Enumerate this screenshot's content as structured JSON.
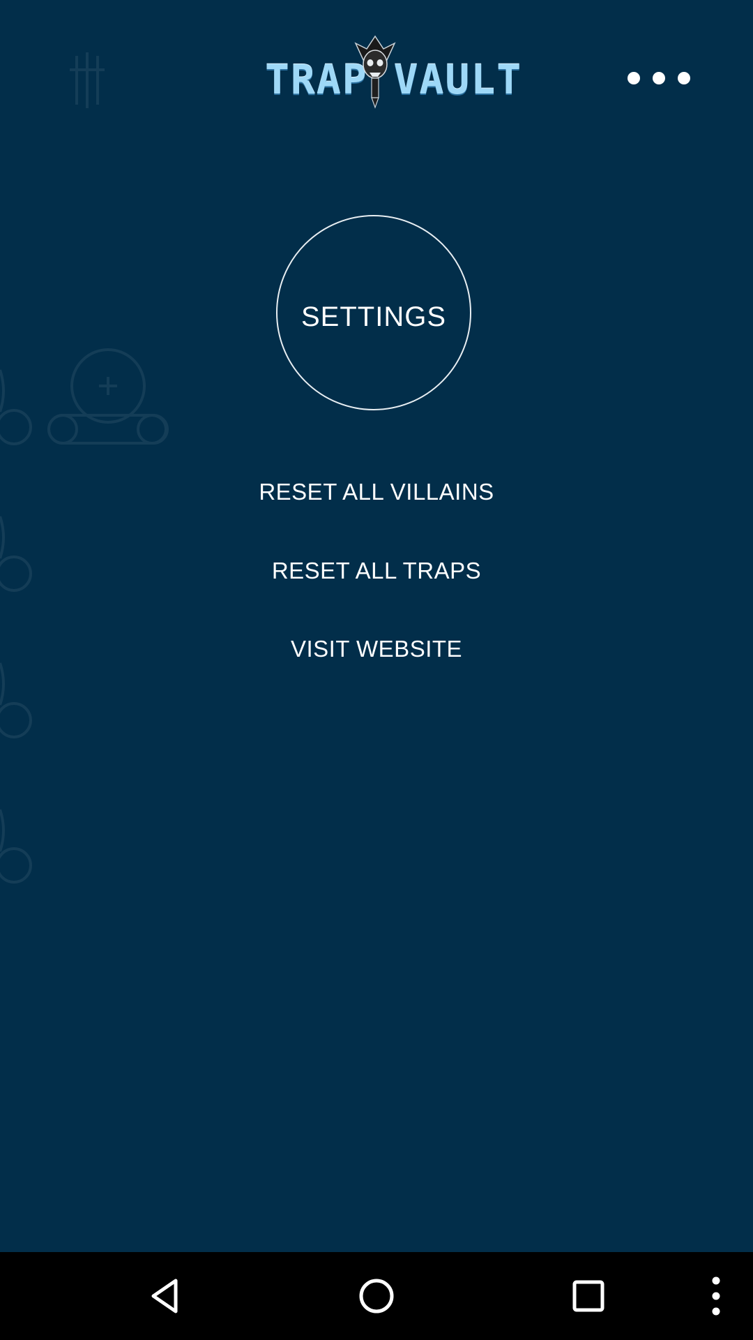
{
  "header": {
    "logo_text": "TRAP VAULT",
    "menu_icon": "more-horizontal-icon"
  },
  "settings": {
    "title": "SETTINGS"
  },
  "menu": {
    "items": [
      {
        "label": "RESET ALL VILLAINS"
      },
      {
        "label": "RESET ALL TRAPS"
      },
      {
        "label": "VISIT WEBSITE"
      }
    ]
  },
  "nav_bar": {
    "back_icon": "back-triangle-icon",
    "home_icon": "home-circle-icon",
    "recents_icon": "recents-square-icon",
    "more_icon": "more-vertical-icon"
  },
  "colors": {
    "background": "#022e4a",
    "text": "#ffffff",
    "logo": "#9ed8f7",
    "nav_bar": "#000000"
  }
}
